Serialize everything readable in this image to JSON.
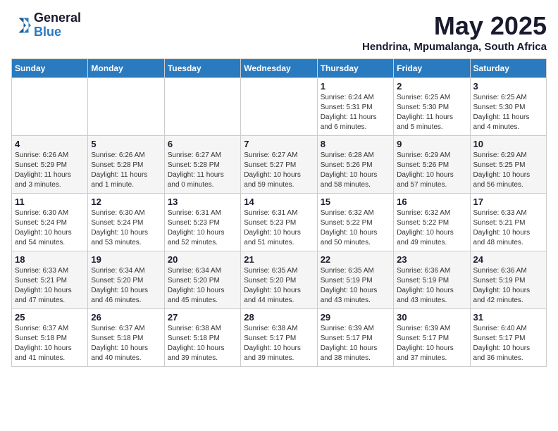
{
  "logo": {
    "general": "General",
    "blue": "Blue"
  },
  "title": "May 2025",
  "subtitle": "Hendrina, Mpumalanga, South Africa",
  "days_of_week": [
    "Sunday",
    "Monday",
    "Tuesday",
    "Wednesday",
    "Thursday",
    "Friday",
    "Saturday"
  ],
  "weeks": [
    [
      {
        "day": "",
        "info": ""
      },
      {
        "day": "",
        "info": ""
      },
      {
        "day": "",
        "info": ""
      },
      {
        "day": "",
        "info": ""
      },
      {
        "day": "1",
        "info": "Sunrise: 6:24 AM\nSunset: 5:31 PM\nDaylight: 11 hours\nand 6 minutes."
      },
      {
        "day": "2",
        "info": "Sunrise: 6:25 AM\nSunset: 5:30 PM\nDaylight: 11 hours\nand 5 minutes."
      },
      {
        "day": "3",
        "info": "Sunrise: 6:25 AM\nSunset: 5:30 PM\nDaylight: 11 hours\nand 4 minutes."
      }
    ],
    [
      {
        "day": "4",
        "info": "Sunrise: 6:26 AM\nSunset: 5:29 PM\nDaylight: 11 hours\nand 3 minutes."
      },
      {
        "day": "5",
        "info": "Sunrise: 6:26 AM\nSunset: 5:28 PM\nDaylight: 11 hours\nand 1 minute."
      },
      {
        "day": "6",
        "info": "Sunrise: 6:27 AM\nSunset: 5:28 PM\nDaylight: 11 hours\nand 0 minutes."
      },
      {
        "day": "7",
        "info": "Sunrise: 6:27 AM\nSunset: 5:27 PM\nDaylight: 10 hours\nand 59 minutes."
      },
      {
        "day": "8",
        "info": "Sunrise: 6:28 AM\nSunset: 5:26 PM\nDaylight: 10 hours\nand 58 minutes."
      },
      {
        "day": "9",
        "info": "Sunrise: 6:29 AM\nSunset: 5:26 PM\nDaylight: 10 hours\nand 57 minutes."
      },
      {
        "day": "10",
        "info": "Sunrise: 6:29 AM\nSunset: 5:25 PM\nDaylight: 10 hours\nand 56 minutes."
      }
    ],
    [
      {
        "day": "11",
        "info": "Sunrise: 6:30 AM\nSunset: 5:24 PM\nDaylight: 10 hours\nand 54 minutes."
      },
      {
        "day": "12",
        "info": "Sunrise: 6:30 AM\nSunset: 5:24 PM\nDaylight: 10 hours\nand 53 minutes."
      },
      {
        "day": "13",
        "info": "Sunrise: 6:31 AM\nSunset: 5:23 PM\nDaylight: 10 hours\nand 52 minutes."
      },
      {
        "day": "14",
        "info": "Sunrise: 6:31 AM\nSunset: 5:23 PM\nDaylight: 10 hours\nand 51 minutes."
      },
      {
        "day": "15",
        "info": "Sunrise: 6:32 AM\nSunset: 5:22 PM\nDaylight: 10 hours\nand 50 minutes."
      },
      {
        "day": "16",
        "info": "Sunrise: 6:32 AM\nSunset: 5:22 PM\nDaylight: 10 hours\nand 49 minutes."
      },
      {
        "day": "17",
        "info": "Sunrise: 6:33 AM\nSunset: 5:21 PM\nDaylight: 10 hours\nand 48 minutes."
      }
    ],
    [
      {
        "day": "18",
        "info": "Sunrise: 6:33 AM\nSunset: 5:21 PM\nDaylight: 10 hours\nand 47 minutes."
      },
      {
        "day": "19",
        "info": "Sunrise: 6:34 AM\nSunset: 5:20 PM\nDaylight: 10 hours\nand 46 minutes."
      },
      {
        "day": "20",
        "info": "Sunrise: 6:34 AM\nSunset: 5:20 PM\nDaylight: 10 hours\nand 45 minutes."
      },
      {
        "day": "21",
        "info": "Sunrise: 6:35 AM\nSunset: 5:20 PM\nDaylight: 10 hours\nand 44 minutes."
      },
      {
        "day": "22",
        "info": "Sunrise: 6:35 AM\nSunset: 5:19 PM\nDaylight: 10 hours\nand 43 minutes."
      },
      {
        "day": "23",
        "info": "Sunrise: 6:36 AM\nSunset: 5:19 PM\nDaylight: 10 hours\nand 43 minutes."
      },
      {
        "day": "24",
        "info": "Sunrise: 6:36 AM\nSunset: 5:19 PM\nDaylight: 10 hours\nand 42 minutes."
      }
    ],
    [
      {
        "day": "25",
        "info": "Sunrise: 6:37 AM\nSunset: 5:18 PM\nDaylight: 10 hours\nand 41 minutes."
      },
      {
        "day": "26",
        "info": "Sunrise: 6:37 AM\nSunset: 5:18 PM\nDaylight: 10 hours\nand 40 minutes."
      },
      {
        "day": "27",
        "info": "Sunrise: 6:38 AM\nSunset: 5:18 PM\nDaylight: 10 hours\nand 39 minutes."
      },
      {
        "day": "28",
        "info": "Sunrise: 6:38 AM\nSunset: 5:17 PM\nDaylight: 10 hours\nand 39 minutes."
      },
      {
        "day": "29",
        "info": "Sunrise: 6:39 AM\nSunset: 5:17 PM\nDaylight: 10 hours\nand 38 minutes."
      },
      {
        "day": "30",
        "info": "Sunrise: 6:39 AM\nSunset: 5:17 PM\nDaylight: 10 hours\nand 37 minutes."
      },
      {
        "day": "31",
        "info": "Sunrise: 6:40 AM\nSunset: 5:17 PM\nDaylight: 10 hours\nand 36 minutes."
      }
    ]
  ]
}
